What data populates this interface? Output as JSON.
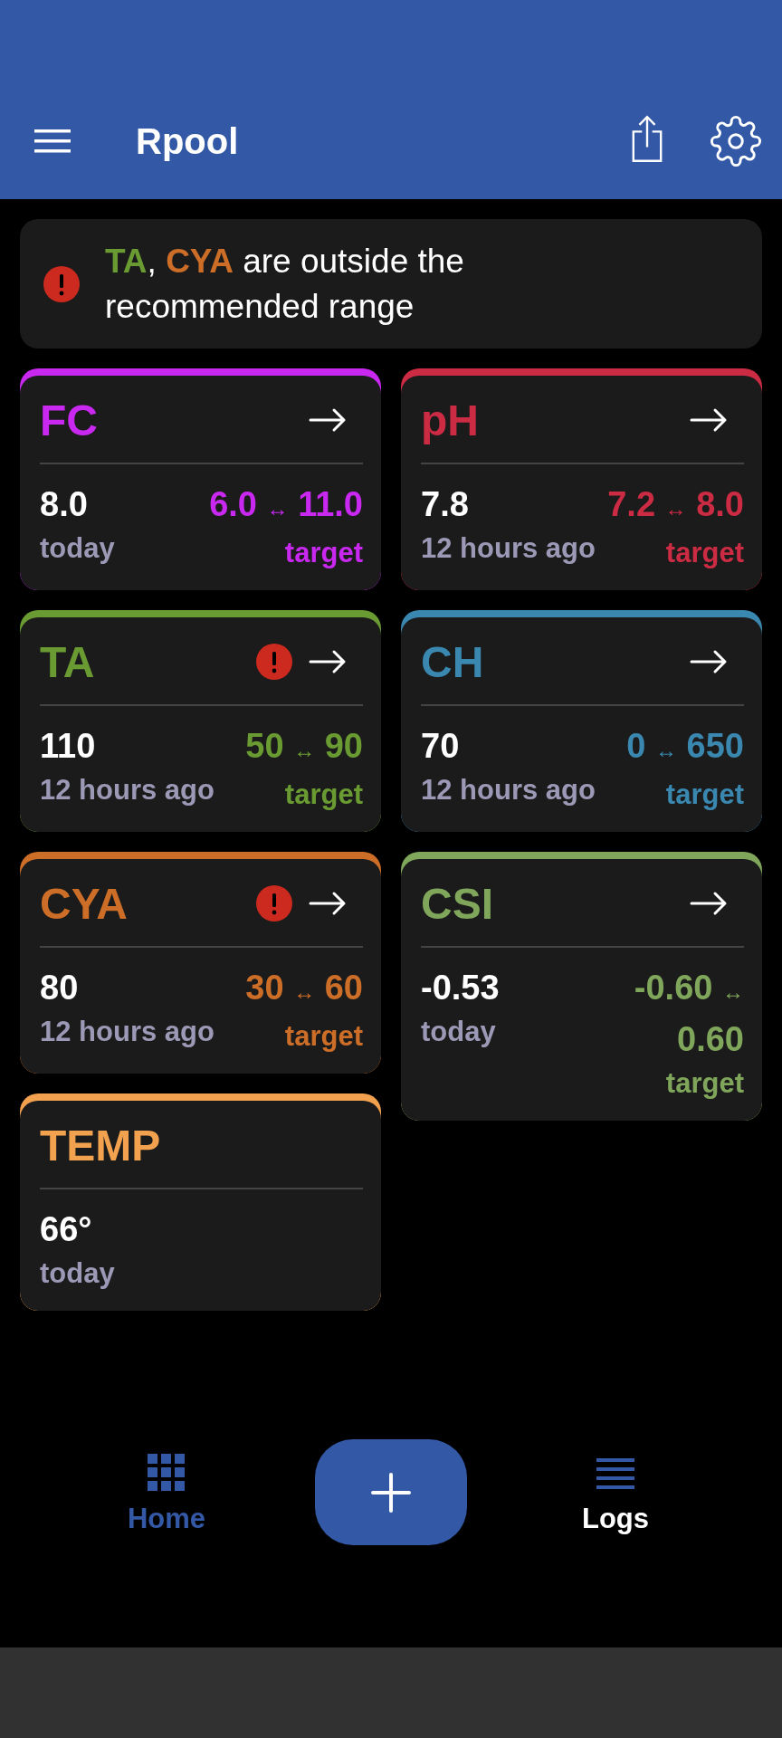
{
  "app_bar": {
    "title": "Rpool"
  },
  "alert": {
    "segments": [
      {
        "text": "TA",
        "color": "#6a9a32"
      },
      {
        "text": ", "
      },
      {
        "text": "CYA",
        "color": "#cc6e28"
      },
      {
        "text": " are outside the recommended range"
      }
    ]
  },
  "cards": [
    {
      "name": "FC",
      "color": "#c828f0",
      "warning": false,
      "link": true,
      "value": "8.0",
      "time": "today",
      "range_low": "6.0",
      "separator": "↔",
      "range_high": "11.0",
      "range_label": "target"
    },
    {
      "name": "pH",
      "color": "#cc2b44",
      "warning": false,
      "link": true,
      "value": "7.8",
      "time": "12 hours ago",
      "range_low": "7.2",
      "separator": "↔",
      "range_high": "8.0",
      "range_label": "target"
    },
    {
      "name": "TA",
      "color": "#6a9a32",
      "warning": true,
      "link": true,
      "value": "110",
      "time": "12 hours ago",
      "range_low": "50",
      "separator": "↔",
      "range_high": "90",
      "range_label": "target"
    },
    {
      "name": "CH",
      "color": "#3a87b0",
      "warning": false,
      "link": true,
      "value": "70",
      "time": "12 hours ago",
      "range_low": "0",
      "separator": "↔",
      "range_high": "650",
      "range_label": "target"
    },
    {
      "name": "CYA",
      "color": "#cc6e28",
      "warning": true,
      "link": true,
      "value": "80",
      "time": "12 hours ago",
      "range_low": "30",
      "separator": "↔",
      "range_high": "60",
      "range_label": "target"
    },
    {
      "name": "CSI",
      "color": "#7fa65a",
      "warning": false,
      "link": true,
      "value": "-0.53",
      "time": "today",
      "range_low": "-0.60",
      "separator": "↔",
      "range_high": "0.60",
      "range_label": "target"
    },
    {
      "name": "TEMP",
      "color": "#f2a14e",
      "warning": false,
      "link": false,
      "value": "66°",
      "time": "today"
    }
  ],
  "bottom_nav": [
    {
      "label": "Home",
      "selected": true
    },
    {
      "label": "Logs",
      "selected": false
    }
  ]
}
